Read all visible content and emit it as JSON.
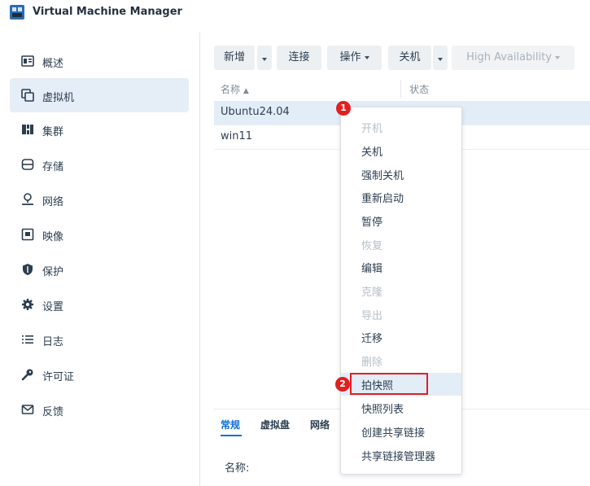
{
  "app": {
    "title": "Virtual Machine Manager",
    "icon": "vmm-app-icon"
  },
  "sidebar": {
    "items": [
      {
        "label": "概述",
        "icon": "overview-icon",
        "active": false
      },
      {
        "label": "虚拟机",
        "icon": "virtual-machine-icon",
        "active": true
      },
      {
        "label": "集群",
        "icon": "cluster-icon",
        "active": false
      },
      {
        "label": "存储",
        "icon": "storage-icon",
        "active": false
      },
      {
        "label": "网络",
        "icon": "network-icon",
        "active": false
      },
      {
        "label": "映像",
        "icon": "image-icon",
        "active": false
      },
      {
        "label": "保护",
        "icon": "shield-icon",
        "active": false
      },
      {
        "label": "设置",
        "icon": "gear-icon",
        "active": false
      },
      {
        "label": "日志",
        "icon": "log-list-icon",
        "active": false
      },
      {
        "label": "许可证",
        "icon": "key-icon",
        "active": false
      },
      {
        "label": "反馈",
        "icon": "mail-icon",
        "active": false
      }
    ]
  },
  "toolbar": {
    "new_label": "新增",
    "connect_label": "连接",
    "action_label": "操作",
    "shutdown_label": "关机",
    "ha_label": "High Availability"
  },
  "grid": {
    "columns": {
      "name": "名称",
      "status": "状态"
    },
    "rows": [
      {
        "name": "Ubuntu24.04",
        "selected": true
      },
      {
        "name": "win11",
        "selected": false
      }
    ]
  },
  "detail": {
    "tabs": [
      "常规",
      "虚拟盘",
      "网络"
    ],
    "name_label": "名称:"
  },
  "context_menu": {
    "items": [
      {
        "label": "开机",
        "enabled": false
      },
      {
        "label": "关机",
        "enabled": true
      },
      {
        "label": "强制关机",
        "enabled": true
      },
      {
        "label": "重新启动",
        "enabled": true
      },
      {
        "label": "暂停",
        "enabled": true
      },
      {
        "label": "恢复",
        "enabled": false
      },
      {
        "label": "编辑",
        "enabled": true
      },
      {
        "label": "克隆",
        "enabled": false
      },
      {
        "label": "导出",
        "enabled": false
      },
      {
        "label": "迁移",
        "enabled": true
      },
      {
        "label": "删除",
        "enabled": false
      },
      {
        "label": "拍快照",
        "enabled": true,
        "highlighted": true
      },
      {
        "label": "快照列表",
        "enabled": true
      },
      {
        "label": "创建共享链接",
        "enabled": true
      },
      {
        "label": "共享链接管理器",
        "enabled": true
      }
    ]
  },
  "annotations": {
    "step1": "1",
    "step2": "2",
    "color": "#e02020"
  }
}
